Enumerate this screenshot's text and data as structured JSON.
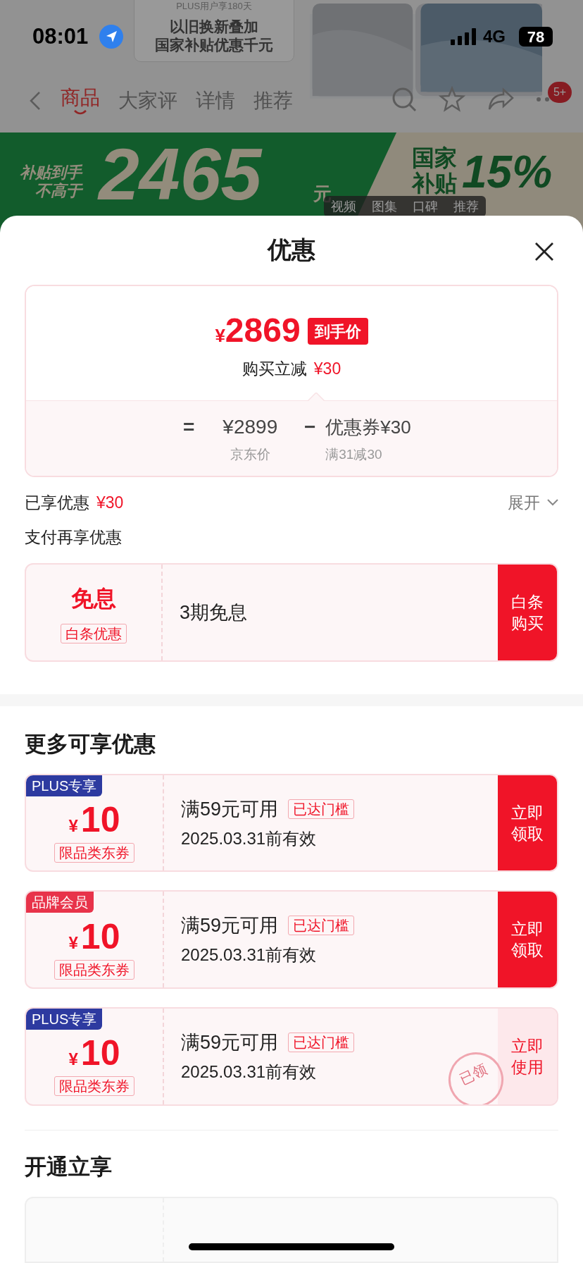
{
  "status_bar": {
    "time": "08:01",
    "network": "4G",
    "battery": "78"
  },
  "background_page": {
    "promo_lines": [
      "PLUS用户享180天",
      "以旧换新叠加",
      "国家补贴优惠千元"
    ],
    "tabs": [
      {
        "label": "商品",
        "selected": true
      },
      {
        "label": "大家评",
        "selected": false
      },
      {
        "label": "详情",
        "selected": false
      },
      {
        "label": "推荐",
        "selected": false
      }
    ],
    "cart_badge": "5+",
    "banner": {
      "left_line1": "补贴到手",
      "left_line2": "不高于",
      "amount": "2465",
      "unit": "元",
      "right_line1": "国家",
      "right_line2": "补贴",
      "percent": "15%"
    },
    "media_tabs": [
      "视频",
      "图集",
      "口碑",
      "推荐"
    ]
  },
  "sheet": {
    "title": "优惠",
    "price_card": {
      "symbol": "¥",
      "price": "2869",
      "price_tag": "到手价",
      "instant_label": "购买立减",
      "instant_amount": "¥30",
      "equals": "=",
      "base_price": "¥2899",
      "minus": "−",
      "coupon": "优惠券¥30",
      "base_label": "京东价",
      "coupon_rule": "满31减30"
    },
    "enjoyed": {
      "label": "已享优惠",
      "amount": "¥30",
      "expand": "展开"
    },
    "pay_section": {
      "title": "支付再享优惠",
      "offer": {
        "title": "免息",
        "tag": "白条优惠",
        "desc": "3期免息",
        "action": "白条购买"
      }
    },
    "more_section": {
      "title": "更多可享优惠",
      "coupons": [
        {
          "badge": "PLUS专享",
          "color": "#2d3aa0",
          "symbol": "¥",
          "amount": "10",
          "scope": "限品类东券",
          "rule": "满59元可用",
          "status": "已达门槛",
          "expiry": "2025.03.31前有效",
          "action": "立即领取",
          "claimed": false
        },
        {
          "badge": "品牌会员",
          "color": "#e8334a",
          "symbol": "¥",
          "amount": "10",
          "scope": "限品类东券",
          "rule": "满59元可用",
          "status": "已达门槛",
          "expiry": "2025.03.31前有效",
          "action": "立即领取",
          "claimed": false
        },
        {
          "badge": "PLUS专享",
          "color": "#2d3aa0",
          "symbol": "¥",
          "amount": "10",
          "scope": "限品类东券",
          "rule": "满59元可用",
          "status": "已达门槛",
          "expiry": "2025.03.31前有效",
          "action": "立即使用",
          "claimed": true,
          "stamp": "已领"
        }
      ]
    },
    "open_section": {
      "title": "开通立享"
    }
  }
}
